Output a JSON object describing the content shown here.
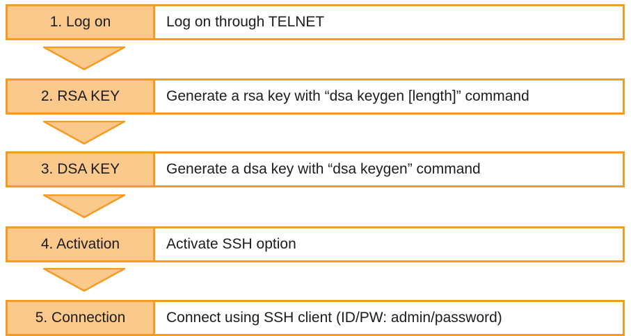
{
  "colors": {
    "border": "#F59A23",
    "label_fill": "#FBC98B",
    "arrow_fill": "#FBC98B",
    "text": "#1c1c1c"
  },
  "steps": [
    {
      "label": "1. Log on",
      "description": "Log on through TELNET"
    },
    {
      "label": "2. RSA KEY",
      "description": "Generate a rsa key with “dsa keygen [length]” command"
    },
    {
      "label": "3. DSA KEY",
      "description": "Generate a dsa key with “dsa keygen” command"
    },
    {
      "label": "4. Activation",
      "description": "Activate SSH option"
    },
    {
      "label": "5. Connection",
      "description": "Connect using SSH client (ID/PW: admin/password)"
    }
  ]
}
